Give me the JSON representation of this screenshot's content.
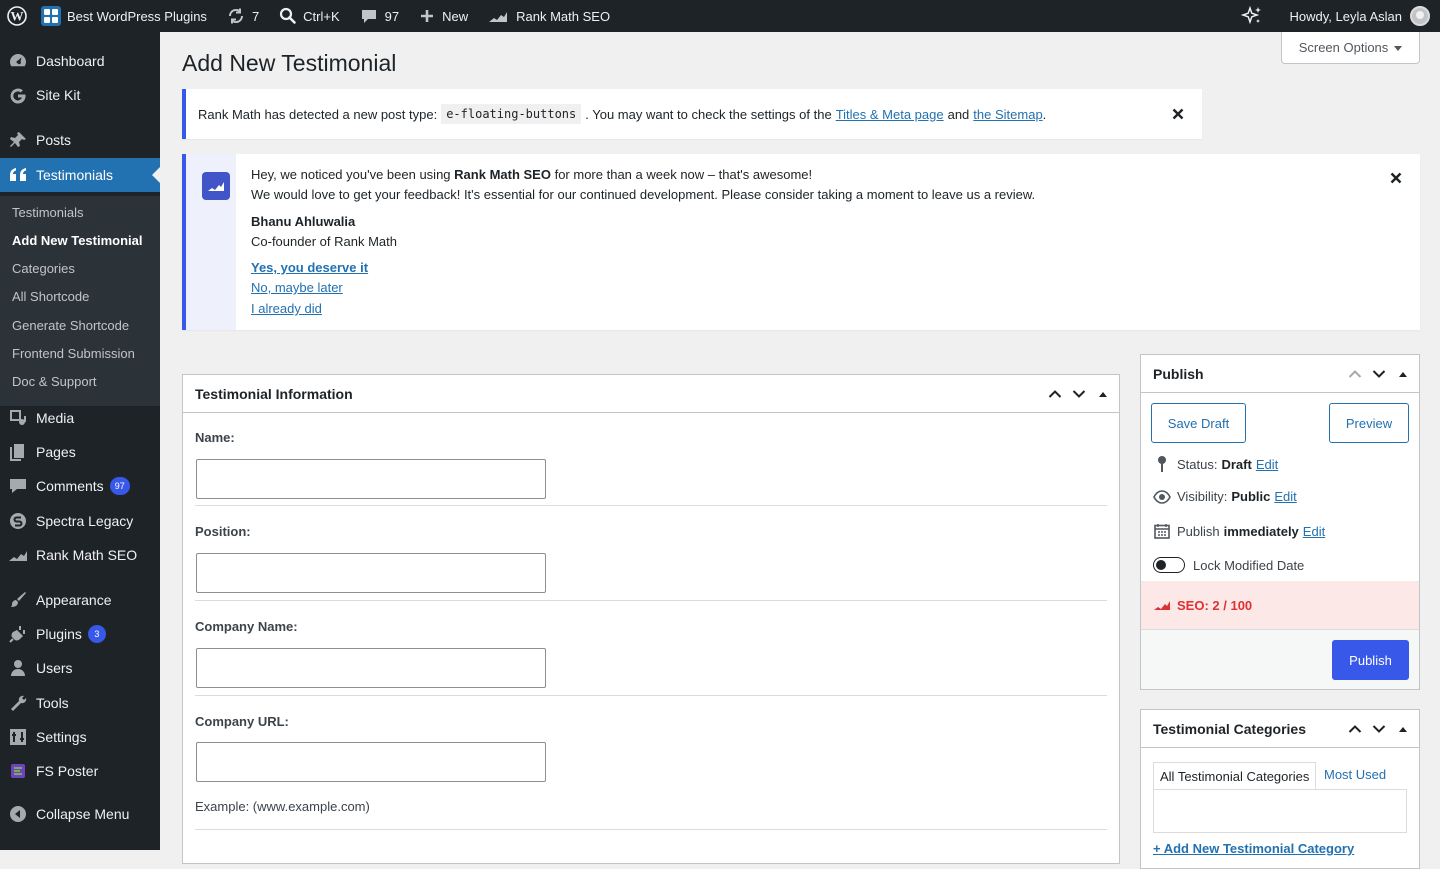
{
  "admin_bar": {
    "site_name": "Best WordPress Plugins",
    "updates_count": "7",
    "search_shortcut": "Ctrl+K",
    "comments_count": "97",
    "new_label": "New",
    "rank_math_label": "Rank Math SEO",
    "howdy": "Howdy, Leyla Aslan"
  },
  "menu": {
    "items": [
      {
        "label": "Dashboard",
        "icon": "dashboard-icon"
      },
      {
        "label": "Site Kit",
        "icon": "google-icon"
      },
      {
        "label": "Posts",
        "icon": "pin-icon"
      },
      {
        "label": "Testimonials",
        "icon": "quote-icon"
      },
      {
        "label": "Media",
        "icon": "media-icon"
      },
      {
        "label": "Pages",
        "icon": "pages-icon"
      },
      {
        "label": "Comments",
        "icon": "comment-icon",
        "badge": "97"
      },
      {
        "label": "Spectra Legacy",
        "icon": "spectra-icon"
      },
      {
        "label": "Rank Math SEO",
        "icon": "rank-math-icon"
      },
      {
        "label": "Appearance",
        "icon": "brush-icon"
      },
      {
        "label": "Plugins",
        "icon": "plugin-icon",
        "badge": "3"
      },
      {
        "label": "Users",
        "icon": "user-icon"
      },
      {
        "label": "Tools",
        "icon": "wrench-icon"
      },
      {
        "label": "Settings",
        "icon": "settings-icon"
      },
      {
        "label": "FS Poster",
        "icon": "fs-poster-icon"
      },
      {
        "label": "Collapse Menu",
        "icon": "collapse-icon"
      }
    ],
    "submenu": [
      "Testimonials",
      "Add New Testimonial",
      "Categories",
      "All Shortcode",
      "Generate Shortcode",
      "Frontend Submission",
      "Doc & Support"
    ]
  },
  "page": {
    "title": "Add New Testimonial",
    "screen_options": "Screen Options"
  },
  "notice1": {
    "text_before": "Rank Math has detected a new post type:",
    "code": "e-floating-buttons",
    "text_middle": ". You may want to check the settings of the",
    "link1": "Titles & Meta page",
    "and": "and",
    "link2": "the Sitemap",
    "period": "."
  },
  "notice2": {
    "line1_before": "Hey, we noticed you've been using",
    "line1_bold": "Rank Math SEO",
    "line1_after": "for more than a week now – that's awesome!",
    "line2": "We would love to get your feedback! It's essential for our continued development. Please consider taking a moment to leave us a review.",
    "author": "Bhanu Ahluwalia",
    "role": "Co-founder of Rank Math",
    "link_yes": "Yes, you deserve it",
    "link_later": "No, maybe later",
    "link_did": "I already did"
  },
  "testimonial_box": {
    "title": "Testimonial Information",
    "fields": {
      "name_label": "Name:",
      "position_label": "Position:",
      "company_label": "Company Name:",
      "url_label": "Company URL:",
      "url_hint": "Example: (www.example.com)"
    }
  },
  "publish_box": {
    "title": "Publish",
    "save_draft": "Save Draft",
    "preview": "Preview",
    "status_label": "Status:",
    "status_value": "Draft",
    "visibility_label": "Visibility:",
    "visibility_value": "Public",
    "publish_label": "Publish",
    "publish_value": "immediately",
    "edit": "Edit",
    "lock_label": "Lock Modified Date",
    "seo_score": "SEO: 2 / 100",
    "publish_button": "Publish"
  },
  "categories_box": {
    "title": "Testimonial Categories",
    "tab_all": "All Testimonial Categories",
    "tab_most_used": "Most Used",
    "add_new": "+ Add New Testimonial Category"
  },
  "colors": {
    "admin_dark": "#1d2327",
    "accent_blue": "#3858e9",
    "link_blue": "#2271b1",
    "seo_red": "#dc3232"
  }
}
